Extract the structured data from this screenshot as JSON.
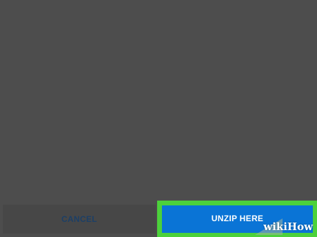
{
  "dialog": {
    "cancel_label": "CANCEL",
    "confirm_label": "UNZIP HERE"
  },
  "watermark": {
    "text_wiki": "wiki",
    "text_how": "How"
  },
  "colors": {
    "background": "#4d4d4d",
    "primary_button": "#0a74d6",
    "highlight": "#4cd13b",
    "cancel_text": "#1c3f66"
  }
}
